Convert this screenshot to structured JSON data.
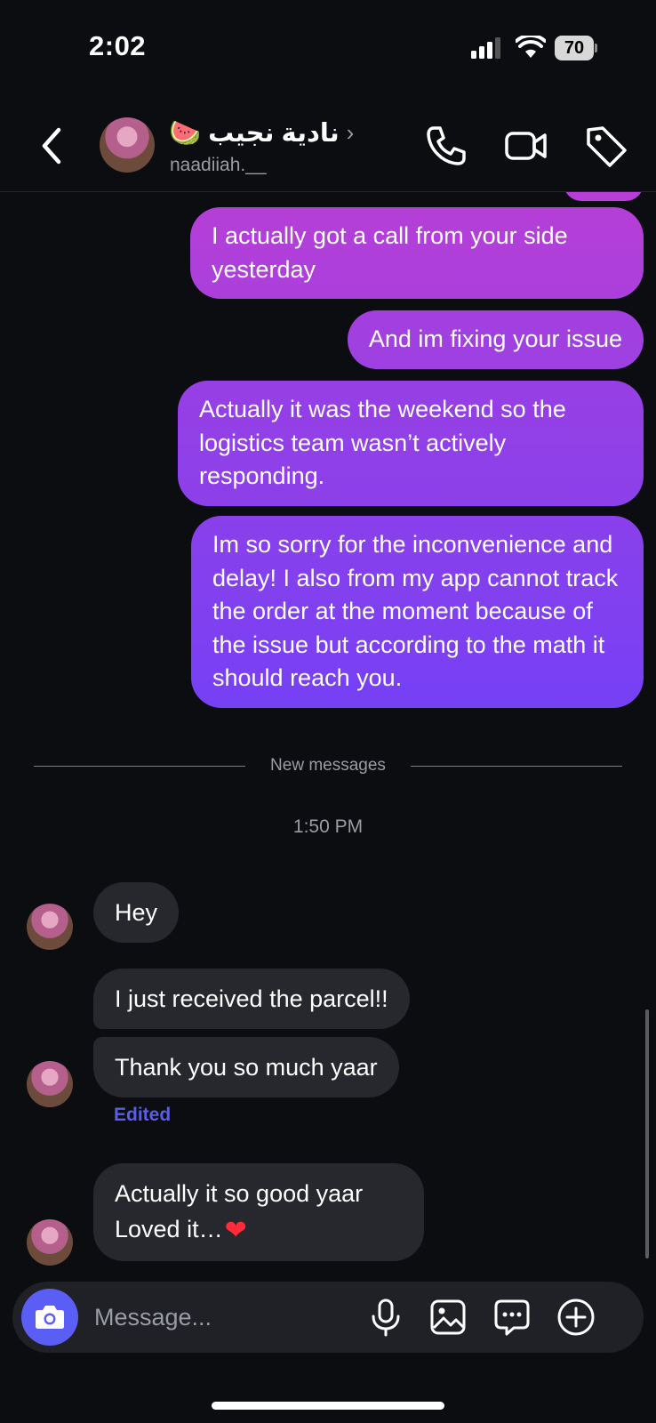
{
  "status_bar": {
    "time": "2:02",
    "battery": "70"
  },
  "header": {
    "contact_name": "نادية نجيب",
    "contact_emoji": "🍉",
    "username": "naadiiah.__"
  },
  "chat": {
    "outgoing": [
      "I actually got a call from your side yesterday",
      "And im fixing your issue",
      "Actually it was the weekend so the logistics team wasn’t actively responding.",
      "Im so sorry for the inconvenience and delay! I also from my app cannot track the order at the moment because of the issue but according to the math it should reach you."
    ],
    "divider_label": "New messages",
    "timestamp": "1:50 PM",
    "incoming": [
      "Hey",
      "I just received the parcel!!",
      "Thank you so much yaar"
    ],
    "edited_label": "Edited",
    "last_incoming_line1": "Actually it so good yaar",
    "last_incoming_line2": "Loved it…",
    "heart": "❤"
  },
  "composer": {
    "placeholder": "Message..."
  },
  "colors": {
    "background": "#0c0d10",
    "incoming_bubble": "#26282d",
    "outgoing_top": "#b33fd8",
    "outgoing_bottom": "#7a40f2",
    "accent": "#5b5ef4",
    "edited": "#5a5ee6"
  }
}
